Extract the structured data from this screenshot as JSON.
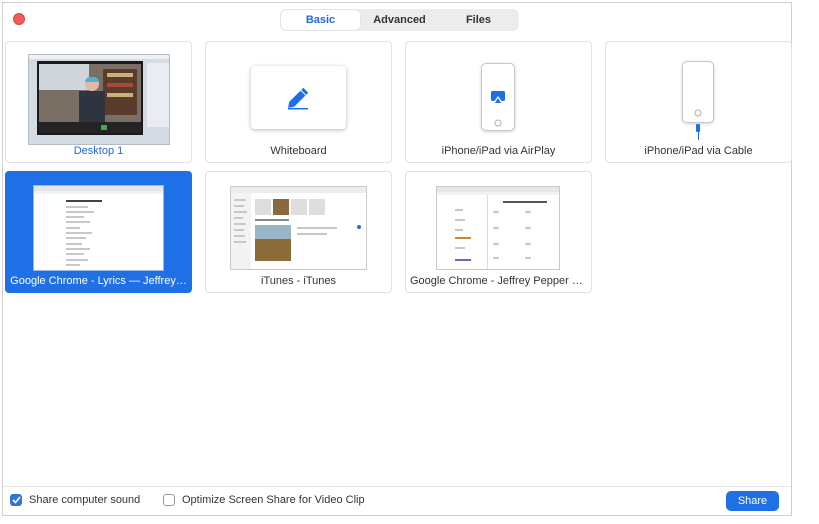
{
  "tabs": [
    {
      "label": "Basic",
      "active": true
    },
    {
      "label": "Advanced",
      "active": false
    },
    {
      "label": "Files",
      "active": false
    }
  ],
  "cards": [
    {
      "label": "Desktop 1",
      "icon": "desktop-thumbnail",
      "selected": false,
      "label_color": "#2468d6"
    },
    {
      "label": "Whiteboard",
      "icon": "pencil-icon",
      "selected": false
    },
    {
      "label": "iPhone/iPad via AirPlay",
      "icon": "airplay-icon",
      "selected": false
    },
    {
      "label": "iPhone/iPad via Cable",
      "icon": "cable-icon",
      "selected": false
    },
    {
      "label": "Google Chrome - Lyrics — Jeffrey…",
      "icon": "document-thumbnail",
      "selected": true
    },
    {
      "label": "iTunes - iTunes",
      "icon": "itunes-thumbnail",
      "selected": false
    },
    {
      "label": "Google Chrome - Jeffrey Pepper R…",
      "icon": "calendar-thumbnail",
      "selected": false
    }
  ],
  "footer": {
    "share_sound_label": "Share computer sound",
    "share_sound_checked": true,
    "optimize_label": "Optimize Screen Share for Video Clip",
    "optimize_checked": false,
    "share_button": "Share"
  },
  "colors": {
    "accent": "#1f6fe6",
    "close": "#f25b57",
    "link": "#2468d6"
  }
}
